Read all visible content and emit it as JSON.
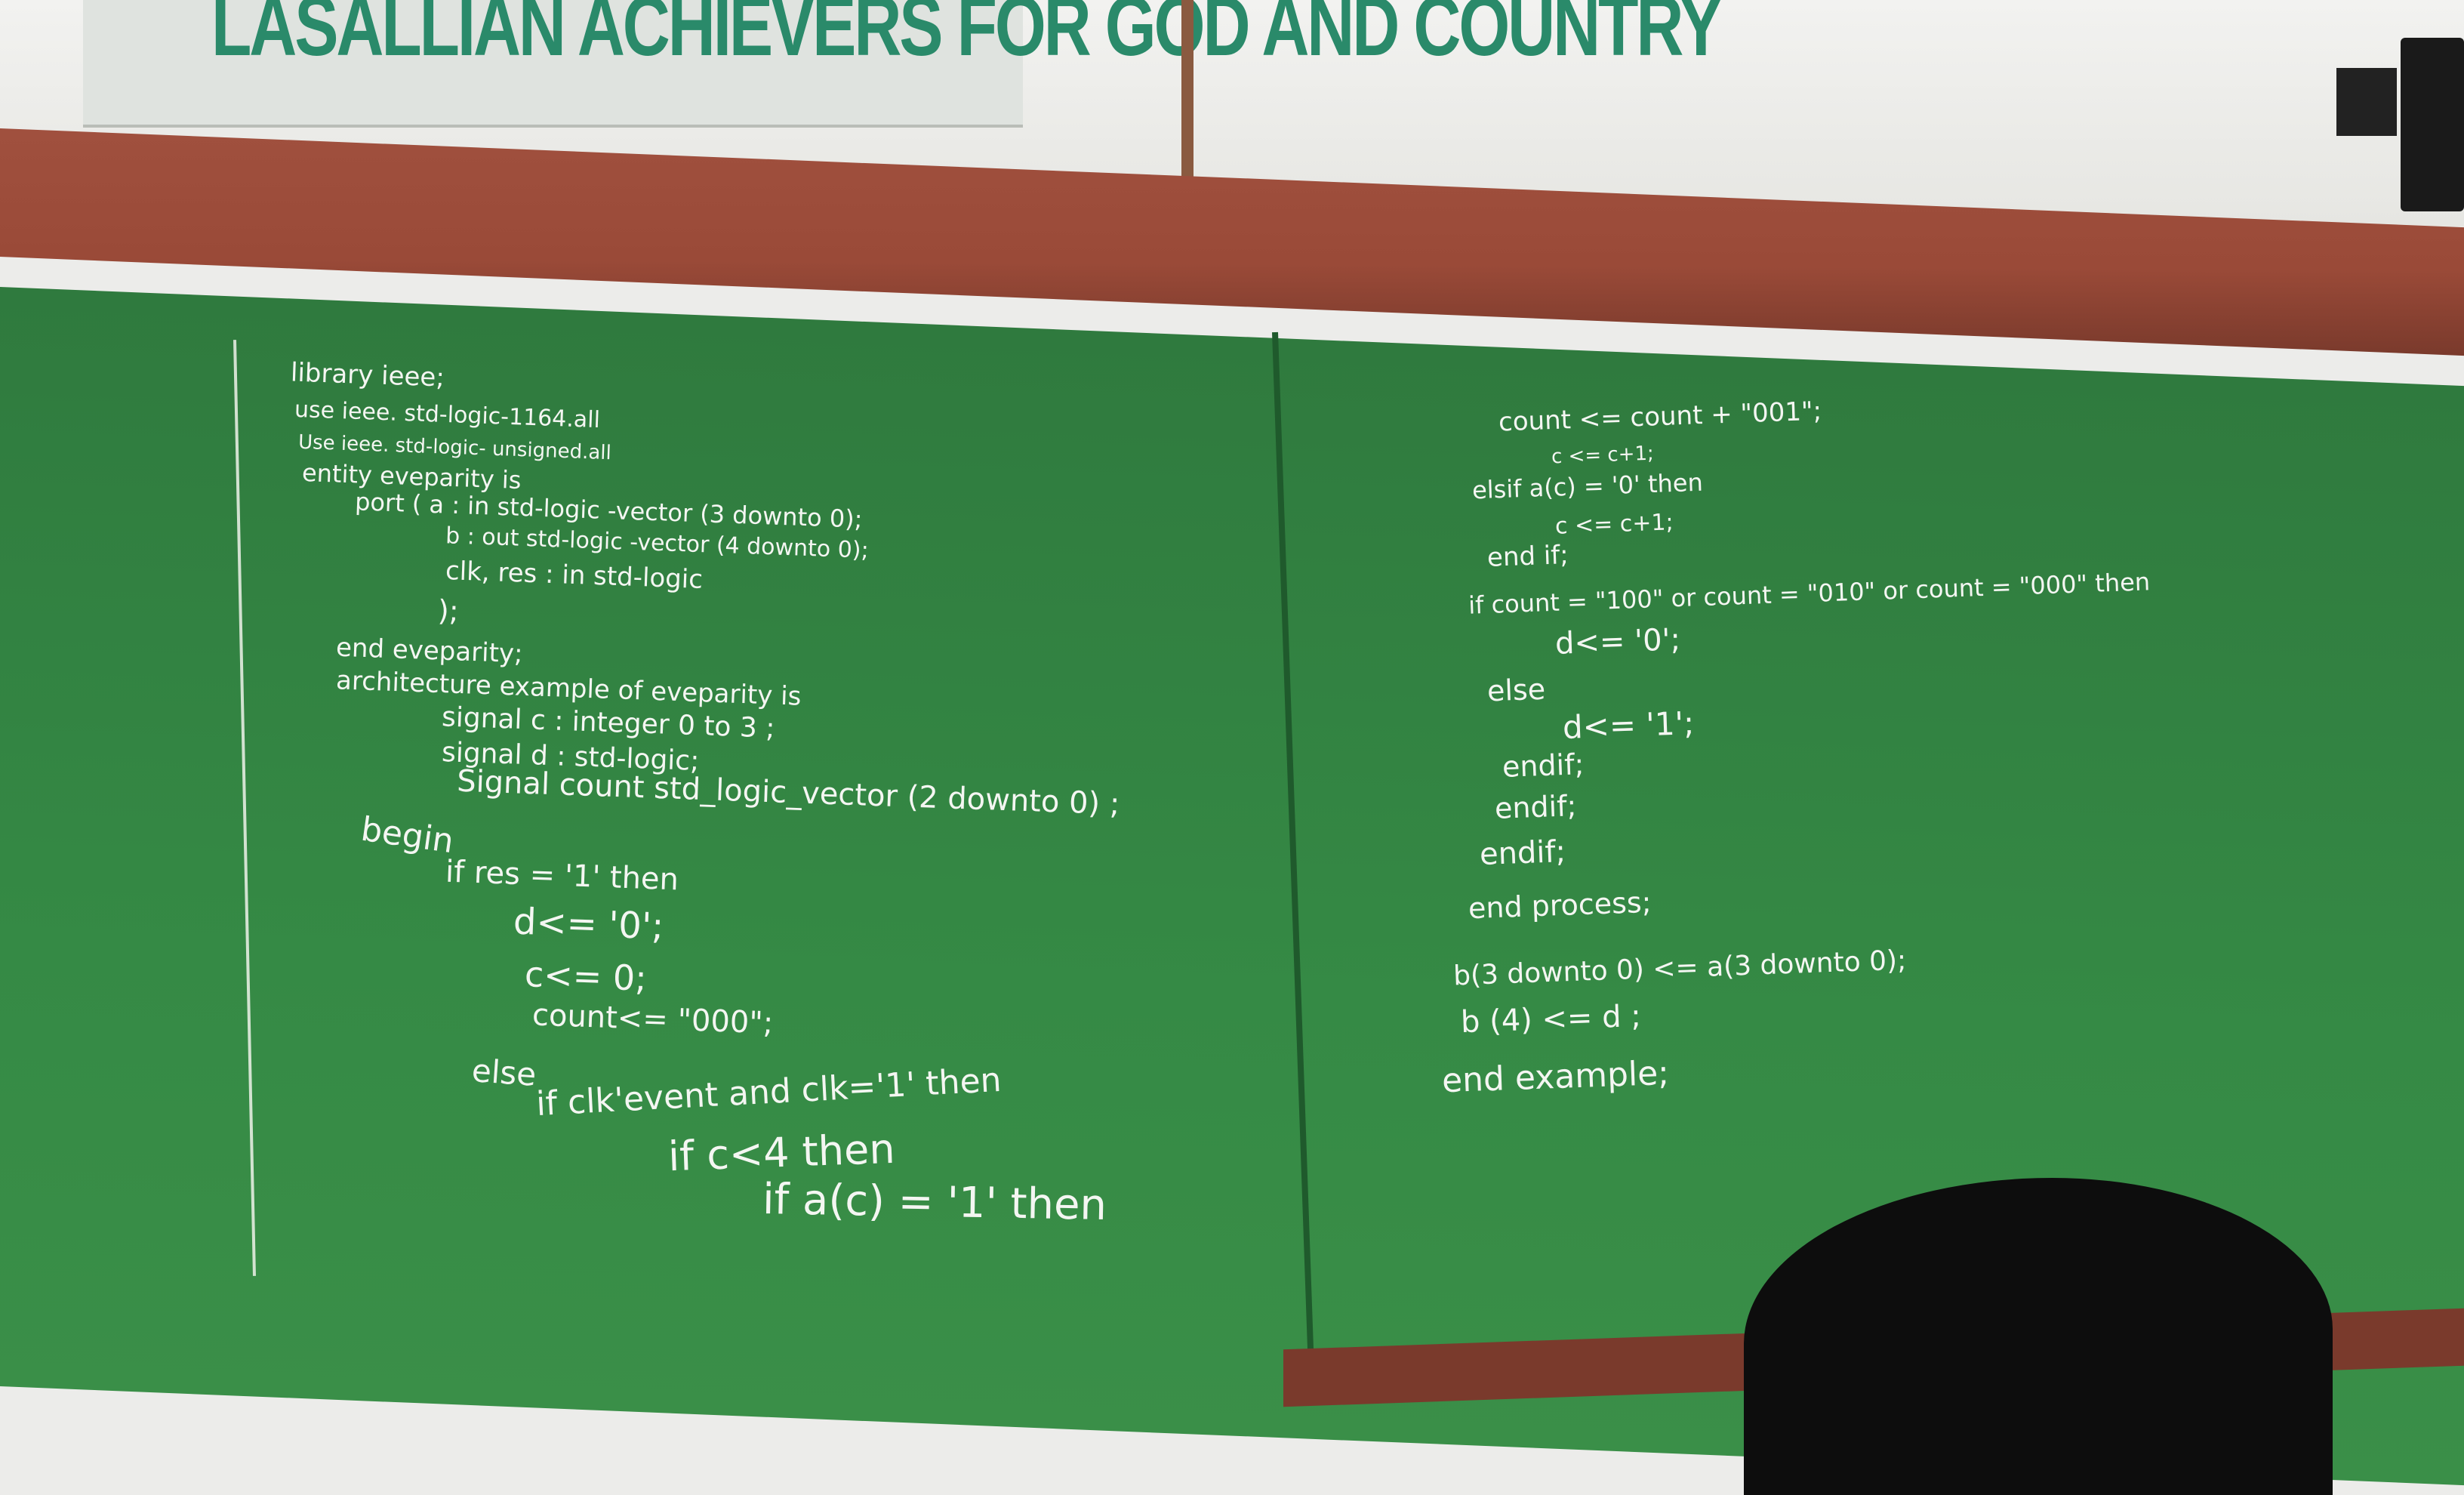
{
  "banner": {
    "text": "LASALLIAN ACHIEVERS FOR GOD AND COUNTRY"
  },
  "left_board": {
    "lines": [
      "library ieee;",
      "use ieee. std-logic-1164.all",
      "Use ieee. std-logic- unsigned.all",
      "entity eveparity is",
      "port ( a : in std-logic -vector (3 downto 0);",
      "b : out std-logic -vector (4 downto 0);",
      "clk, res : in std-logic",
      ");",
      "end eveparity;",
      "architecture example of eveparity is",
      "signal c : integer 0 to 3 ;",
      "signal d : std-logic;",
      "Signal count std_logic_vector (2 downto 0) ;",
      "begin",
      "if res = '1' then",
      "d<= '0';",
      "c<= 0;",
      "count<= \"000\";",
      "else",
      "if clk'event and clk='1' then",
      "if c<4 then",
      "if a(c) = '1' then"
    ]
  },
  "right_board": {
    "lines": [
      "count <= count + \"001\";",
      "c <= c+1;",
      "elsif a(c) = '0' then",
      "c <= c+1;",
      "end if;",
      "if count = \"100\" or count = \"010\" or count = \"000\" then",
      "d<= '0';",
      "else",
      "d<= '1';",
      "endif;",
      "endif;",
      "endif;",
      "end process;",
      "b(3 downto 0) <= a(3 downto 0);",
      "b (4) <= d ;",
      "end example;"
    ]
  },
  "colors": {
    "board": "#358a45",
    "frame": "#9a4a38",
    "chalk": "#f4f6f2",
    "banner_text": "#2a8a6a"
  }
}
